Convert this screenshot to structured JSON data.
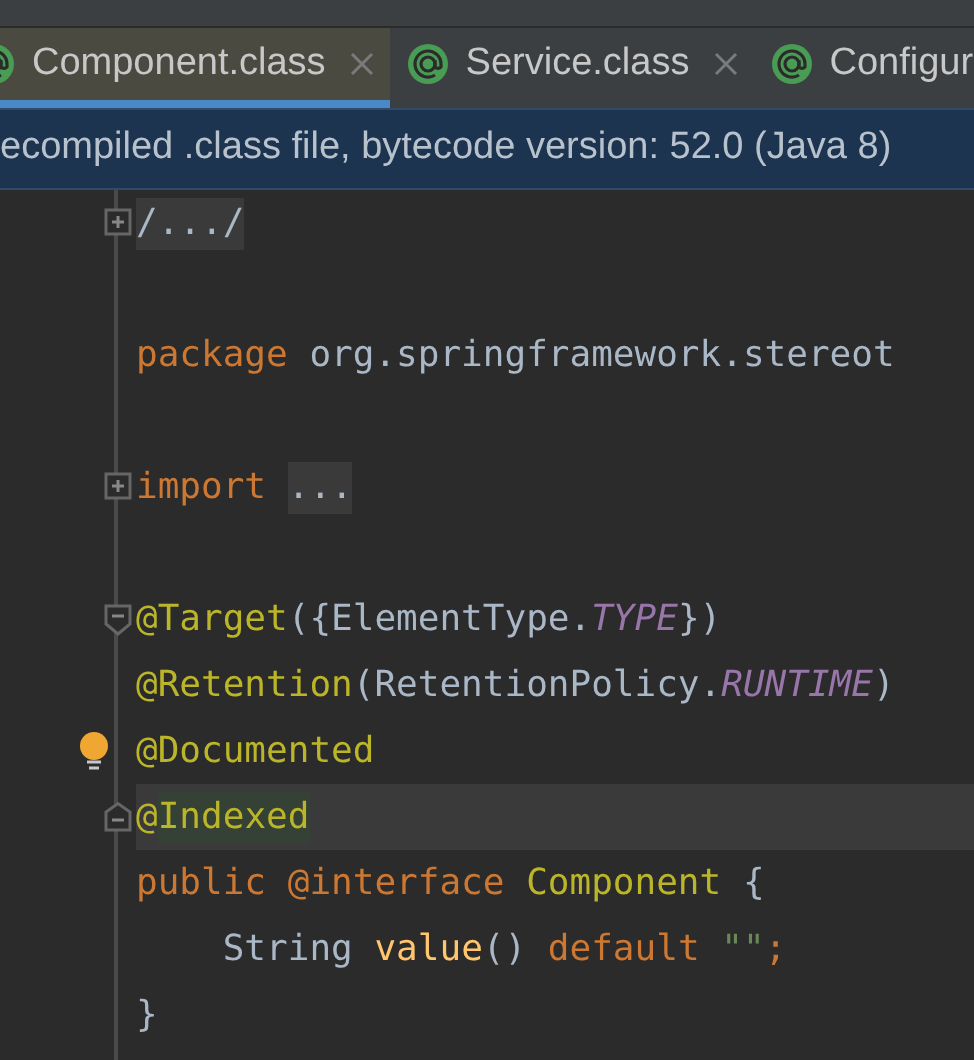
{
  "tabs": [
    {
      "label": "Component.class",
      "selected": true,
      "closable": true
    },
    {
      "label": "Service.class",
      "selected": false,
      "closable": true
    },
    {
      "label": "Configur",
      "selected": false,
      "closable": false
    }
  ],
  "banner": "ecompiled .class file, bytecode version: 52.0 (Java 8)",
  "lines": [
    {
      "fold_marker": {
        "kind": "collapsed"
      },
      "current": false,
      "tokens": [
        {
          "text": "/.../",
          "kind": "folded"
        }
      ]
    },
    {
      "current": false
    },
    {
      "current": false,
      "tokens": [
        {
          "text": "package ",
          "kind": "keyword"
        },
        {
          "text": "org.springframework.stereot",
          "kind": "plain"
        }
      ]
    },
    {
      "current": false
    },
    {
      "fold_marker": {
        "kind": "collapsed"
      },
      "current": false,
      "tokens": [
        {
          "text": "import ",
          "kind": "keyword"
        },
        {
          "text": "...",
          "kind": "folded"
        }
      ]
    },
    {
      "current": false
    },
    {
      "fold_marker": {
        "kind": "start"
      },
      "current": false,
      "tokens": [
        {
          "text": "@Target",
          "kind": "annotation"
        },
        {
          "text": "({ElementType.",
          "kind": "plain"
        },
        {
          "text": "TYPE",
          "kind": "constant"
        },
        {
          "text": "})",
          "kind": "plain"
        }
      ]
    },
    {
      "current": false,
      "tokens": [
        {
          "text": "@Retention",
          "kind": "annotation"
        },
        {
          "text": "(RetentionPolicy.",
          "kind": "plain"
        },
        {
          "text": "RUNTIME",
          "kind": "constant"
        },
        {
          "text": ")",
          "kind": "plain"
        }
      ]
    },
    {
      "bulb": true,
      "current": false,
      "tokens": [
        {
          "text": "@Documented",
          "kind": "annotation"
        }
      ]
    },
    {
      "fold_marker": {
        "kind": "end"
      },
      "current": true,
      "tokens": [
        {
          "text": "@",
          "kind": "annotation"
        },
        {
          "text": "Indexed",
          "kind": "match"
        }
      ]
    },
    {
      "current": false,
      "tokens": [
        {
          "text": "public ",
          "kind": "keyword"
        },
        {
          "text": "@interface ",
          "kind": "keyword"
        },
        {
          "text": "Component",
          "kind": "annotation"
        },
        {
          "text": " {",
          "kind": "plain"
        }
      ]
    },
    {
      "current": false,
      "tokens": [
        {
          "text": "    String ",
          "kind": "plain"
        },
        {
          "text": "value",
          "kind": "method"
        },
        {
          "text": "() ",
          "kind": "plain"
        },
        {
          "text": "default ",
          "kind": "keyword"
        },
        {
          "text": "\"\"",
          "kind": "string"
        },
        {
          "text": ";",
          "kind": "keyword"
        }
      ]
    },
    {
      "current": false,
      "tokens": [
        {
          "text": "}",
          "kind": "plain"
        }
      ]
    }
  ]
}
